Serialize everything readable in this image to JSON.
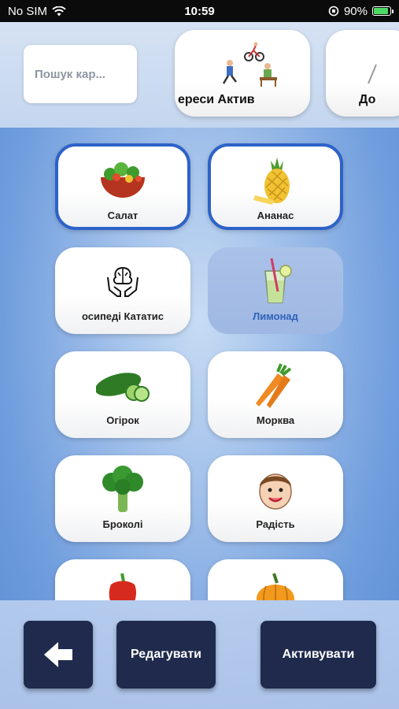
{
  "status": {
    "carrier": "No SIM",
    "time": "10:59",
    "battery": "90%"
  },
  "search": {
    "placeholder": "Пошук кар..."
  },
  "categories": [
    {
      "label": "ереси   Актив"
    },
    {
      "label": "До"
    }
  ],
  "tiles": [
    {
      "label": "Салат",
      "icon": "salad-icon",
      "selected": true
    },
    {
      "label": "Ананас",
      "icon": "pineapple-icon",
      "selected": true
    },
    {
      "label": "осипеді   Кататис",
      "icon": "brain-hands-icon",
      "selected": false
    },
    {
      "label": "Лимонад",
      "icon": "lemonade-icon",
      "selected": false,
      "dimmed": true
    },
    {
      "label": "Огірок",
      "icon": "cucumber-icon",
      "selected": false
    },
    {
      "label": "Морква",
      "icon": "carrot-icon",
      "selected": false
    },
    {
      "label": "Броколі",
      "icon": "broccoli-icon",
      "selected": false
    },
    {
      "label": "Радість",
      "icon": "happy-face-icon",
      "selected": false
    },
    {
      "label": "",
      "icon": "red-pepper-icon",
      "selected": false
    },
    {
      "label": "",
      "icon": "pumpkin-icon",
      "selected": false
    }
  ],
  "buttons": {
    "back_icon": "arrow-left-icon",
    "edit": "Редагувати",
    "activate": "Активувати"
  },
  "colors": {
    "selected_border": "#2d63c8",
    "button_bg": "#1f2a4c"
  }
}
